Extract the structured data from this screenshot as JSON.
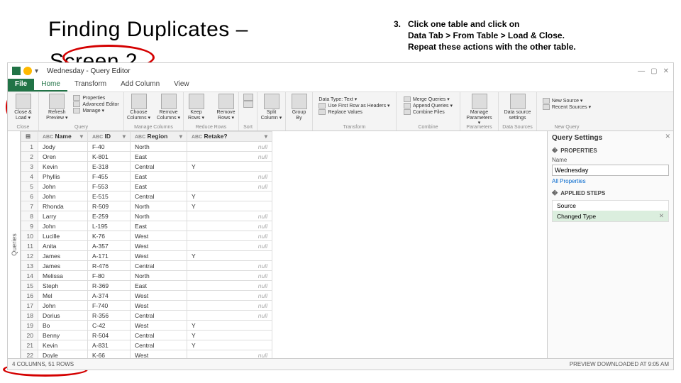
{
  "slide": {
    "title": "Finding Duplicates –",
    "subtitle": "Screen 2"
  },
  "instruction": {
    "num": "3.",
    "lines": [
      "Click one table and click on",
      "Data Tab > From Table > Load & Close.",
      "Repeat these actions with the other table."
    ]
  },
  "titlebar": {
    "doc": "Wednesday - Query Editor",
    "window_controls": {
      "min": "—",
      "max": "▢",
      "close": "✕"
    }
  },
  "tabs": {
    "file": "File",
    "items": [
      "Home",
      "Transform",
      "Add Column",
      "View"
    ],
    "active": 0
  },
  "ribbon": {
    "close": {
      "big": "Close &",
      "big2": "Load ▾",
      "group": "Close"
    },
    "query": {
      "refresh": "Refresh",
      "refresh2": "Preview ▾",
      "opts": [
        "Properties",
        "Advanced Editor",
        "Manage ▾"
      ],
      "group": "Query"
    },
    "cols": {
      "choose": "Choose",
      "choose2": "Columns ▾",
      "remove": "Remove",
      "remove2": "Columns ▾",
      "group": "Manage Columns"
    },
    "rows": {
      "keep": "Keep",
      "keep2": "Rows ▾",
      "remove": "Remove",
      "remove2": "Rows ▾",
      "group": "Reduce Rows"
    },
    "sort": {
      "group": "Sort"
    },
    "split": {
      "big": "Split",
      "big2": "Column ▾"
    },
    "groupby": {
      "big": "Group",
      "big2": "By"
    },
    "transform": {
      "opts": [
        "Data Type: Text ▾",
        "Use First Row as Headers ▾",
        "Replace Values"
      ],
      "group": "Transform"
    },
    "combine": {
      "opts": [
        "Merge Queries ▾",
        "Append Queries ▾",
        "Combine Files"
      ],
      "group": "Combine"
    },
    "params": {
      "big": "Manage",
      "big2": "Parameters ▾",
      "group": "Parameters"
    },
    "ds": {
      "big": "Data source",
      "big2": "settings",
      "group": "Data Sources"
    },
    "newq": {
      "opts": [
        "New Source ▾",
        "Recent Sources ▾"
      ],
      "group": "New Query"
    }
  },
  "rail": {
    "label": "Queries"
  },
  "columns": [
    "",
    "Name",
    "ID",
    "Region",
    "Retake?"
  ],
  "types": [
    "",
    "ABC",
    "ABC",
    "ABC",
    "ABC"
  ],
  "rows": [
    {
      "n": 1,
      "name": "Jody",
      "id": "F-40",
      "region": "North",
      "retake": null
    },
    {
      "n": 2,
      "name": "Oren",
      "id": "K-801",
      "region": "East",
      "retake": null
    },
    {
      "n": 3,
      "name": "Kevin",
      "id": "E-318",
      "region": "Central",
      "retake": "Y"
    },
    {
      "n": 4,
      "name": "Phyllis",
      "id": "F-455",
      "region": "East",
      "retake": null
    },
    {
      "n": 5,
      "name": "John",
      "id": "F-553",
      "region": "East",
      "retake": null
    },
    {
      "n": 6,
      "name": "John",
      "id": "E-515",
      "region": "Central",
      "retake": "Y"
    },
    {
      "n": 7,
      "name": "Rhonda",
      "id": "R-509",
      "region": "North",
      "retake": "Y"
    },
    {
      "n": 8,
      "name": "Larry",
      "id": "E-259",
      "region": "North",
      "retake": null
    },
    {
      "n": 9,
      "name": "John",
      "id": "L-195",
      "region": "East",
      "retake": null
    },
    {
      "n": 10,
      "name": "Lucille",
      "id": "K-76",
      "region": "West",
      "retake": null
    },
    {
      "n": 11,
      "name": "Anita",
      "id": "A-357",
      "region": "West",
      "retake": null
    },
    {
      "n": 12,
      "name": "James",
      "id": "A-171",
      "region": "West",
      "retake": "Y"
    },
    {
      "n": 13,
      "name": "James",
      "id": "R-476",
      "region": "Central",
      "retake": null
    },
    {
      "n": 14,
      "name": "Melissa",
      "id": "F-80",
      "region": "North",
      "retake": null
    },
    {
      "n": 15,
      "name": "Steph",
      "id": "R-369",
      "region": "East",
      "retake": null
    },
    {
      "n": 16,
      "name": "Mel",
      "id": "A-374",
      "region": "West",
      "retake": null
    },
    {
      "n": 17,
      "name": "John",
      "id": "F-740",
      "region": "West",
      "retake": null
    },
    {
      "n": 18,
      "name": "Dorius",
      "id": "R-356",
      "region": "Central",
      "retake": null
    },
    {
      "n": 19,
      "name": "Bo",
      "id": "C-42",
      "region": "West",
      "retake": "Y"
    },
    {
      "n": 20,
      "name": "Benny",
      "id": "R-504",
      "region": "Central",
      "retake": "Y"
    },
    {
      "n": 21,
      "name": "Kevin",
      "id": "A-831",
      "region": "Central",
      "retake": "Y"
    },
    {
      "n": 22,
      "name": "Doyle",
      "id": "K-66",
      "region": "West",
      "retake": null
    }
  ],
  "settings": {
    "title": "Query Settings",
    "props": "PROPERTIES",
    "name_lbl": "Name",
    "name_val": "Wednesday",
    "all_props": "All Properties",
    "steps_hdr": "APPLIED STEPS",
    "steps": [
      "Source",
      "Changed Type"
    ],
    "selected_step": 1
  },
  "status": {
    "left": "4 COLUMNS, 51 ROWS",
    "right": "PREVIEW DOWNLOADED AT 9:05 AM"
  }
}
